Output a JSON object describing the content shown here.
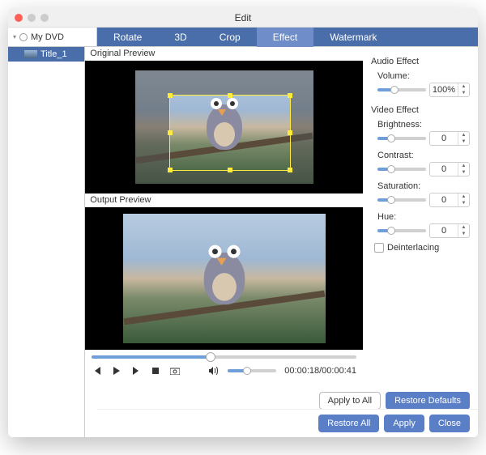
{
  "window": {
    "title": "Edit"
  },
  "sidebar": {
    "root_label": "My DVD",
    "items": [
      {
        "label": "Title_1"
      }
    ]
  },
  "tabs": [
    {
      "label": "Rotate",
      "active": false
    },
    {
      "label": "3D",
      "active": false
    },
    {
      "label": "Crop",
      "active": false
    },
    {
      "label": "Effect",
      "active": true
    },
    {
      "label": "Watermark",
      "active": false
    }
  ],
  "preview": {
    "original_label": "Original Preview",
    "output_label": "Output Preview"
  },
  "playback": {
    "position_pct": 45,
    "time_display": "00:00:18/00:00:41",
    "volume_pct": 40
  },
  "audio_effect": {
    "title": "Audio Effect",
    "volume_label": "Volume:",
    "volume_value": "100%",
    "volume_pct": 35
  },
  "video_effect": {
    "title": "Video Effect",
    "brightness_label": "Brightness:",
    "brightness_value": "0",
    "brightness_pct": 28,
    "contrast_label": "Contrast:",
    "contrast_value": "0",
    "contrast_pct": 28,
    "saturation_label": "Saturation:",
    "saturation_value": "0",
    "saturation_pct": 28,
    "hue_label": "Hue:",
    "hue_value": "0",
    "hue_pct": 28,
    "deinterlacing_label": "Deinterlacing",
    "deinterlacing_checked": false
  },
  "buttons": {
    "apply_to_all": "Apply to All",
    "restore_defaults": "Restore Defaults",
    "restore_all": "Restore All",
    "apply": "Apply",
    "close": "Close"
  }
}
